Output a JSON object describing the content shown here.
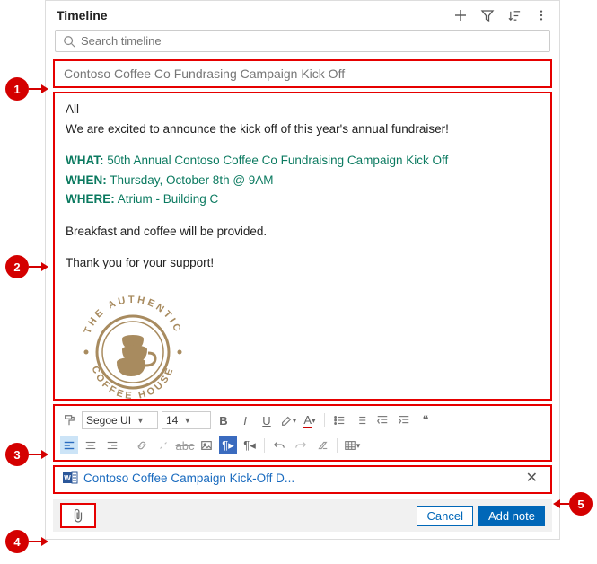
{
  "header": {
    "title": "Timeline"
  },
  "search": {
    "placeholder": "Search timeline"
  },
  "note": {
    "title": "Contoso Coffee Co Fundrasing Campaign Kick Off",
    "greeting": "All",
    "intro": "We are excited to announce the kick off of this year's annual fundraiser!",
    "what_label": "WHAT:",
    "what_value": "50th Annual Contoso Coffee Co Fundraising Campaign Kick Off",
    "when_label": "WHEN:",
    "when_value": "Thursday, October 8th @ 9AM",
    "where_label": "WHERE:",
    "where_value": "Atrium - Building C",
    "extra": "Breakfast and coffee will be provided.",
    "closing": "Thank you for your support!",
    "logo_top": "THE AUTHENTIC",
    "logo_bottom": "COFFEE HOUSE"
  },
  "toolbar": {
    "font": "Segoe UI",
    "size": "14"
  },
  "attachment": {
    "name": "Contoso Coffee Campaign Kick-Off D..."
  },
  "footer": {
    "cancel": "Cancel",
    "add": "Add note"
  },
  "badges": {
    "b1": "1",
    "b2": "2",
    "b3": "3",
    "b4": "4",
    "b5": "5"
  }
}
